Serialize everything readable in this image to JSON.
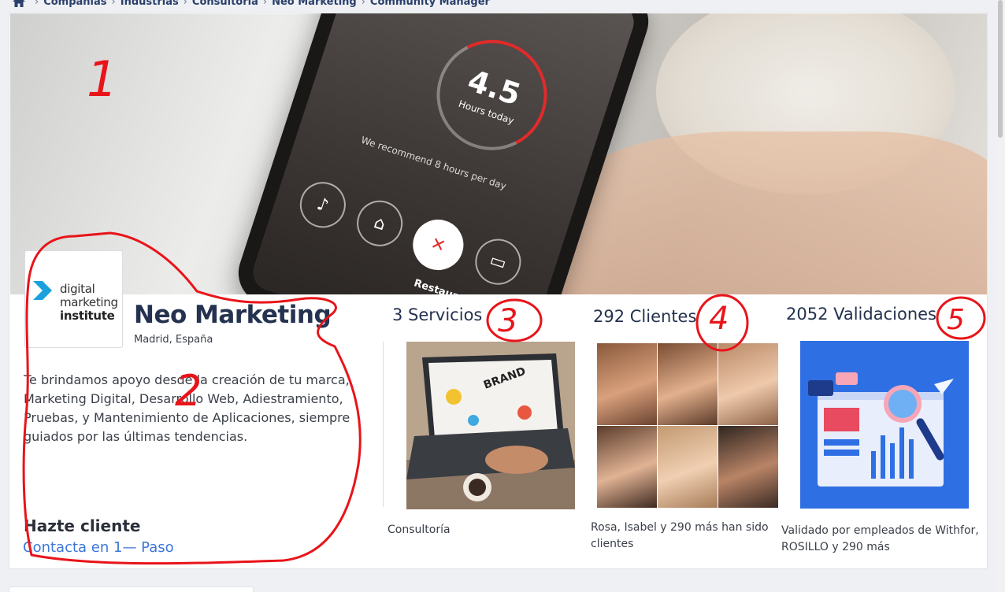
{
  "breadcrumb": {
    "items": [
      "Compañías",
      "Industrias",
      "Consultoría",
      "Neo Marketing",
      "Community Manager"
    ]
  },
  "cover": {
    "phone_metric": "4.5",
    "phone_metric_sub": "Hours today",
    "phone_recommend": "We recommend 8 hours per day",
    "phone_active_label": "Restaurant"
  },
  "company": {
    "logo_lines": [
      "digital",
      "marketing",
      "institute"
    ],
    "name": "Neo Marketing",
    "location": "Madrid, España",
    "description": "Te brindamos apoyo desde la creación de tu marca, Marketing Digital, Desarrollo Web, Adiestramiento, Pruebas, y Mantenimiento de Aplicaciones, siempre guiados por las últimas tendencias.",
    "cta_title": "Hazte cliente",
    "cta_link": "Contacta en 1— Paso"
  },
  "services": {
    "title": "3 Servicios",
    "caption": "Consultoría"
  },
  "clients": {
    "title": "292 Clientes",
    "caption": "Rosa, Isabel y 290 más han sido clientes"
  },
  "validations": {
    "title": "2052 Validaciones",
    "caption": "Validado por empleados de Withfor, ROSILLO y 290 más"
  },
  "annotations": [
    "1",
    "2",
    "3",
    "4",
    "5"
  ],
  "colors": {
    "accent_link": "#3c76d8",
    "title_dark": "#24324f",
    "annotation_red": "#e8141a",
    "validation_bg": "#2f6fe4"
  }
}
